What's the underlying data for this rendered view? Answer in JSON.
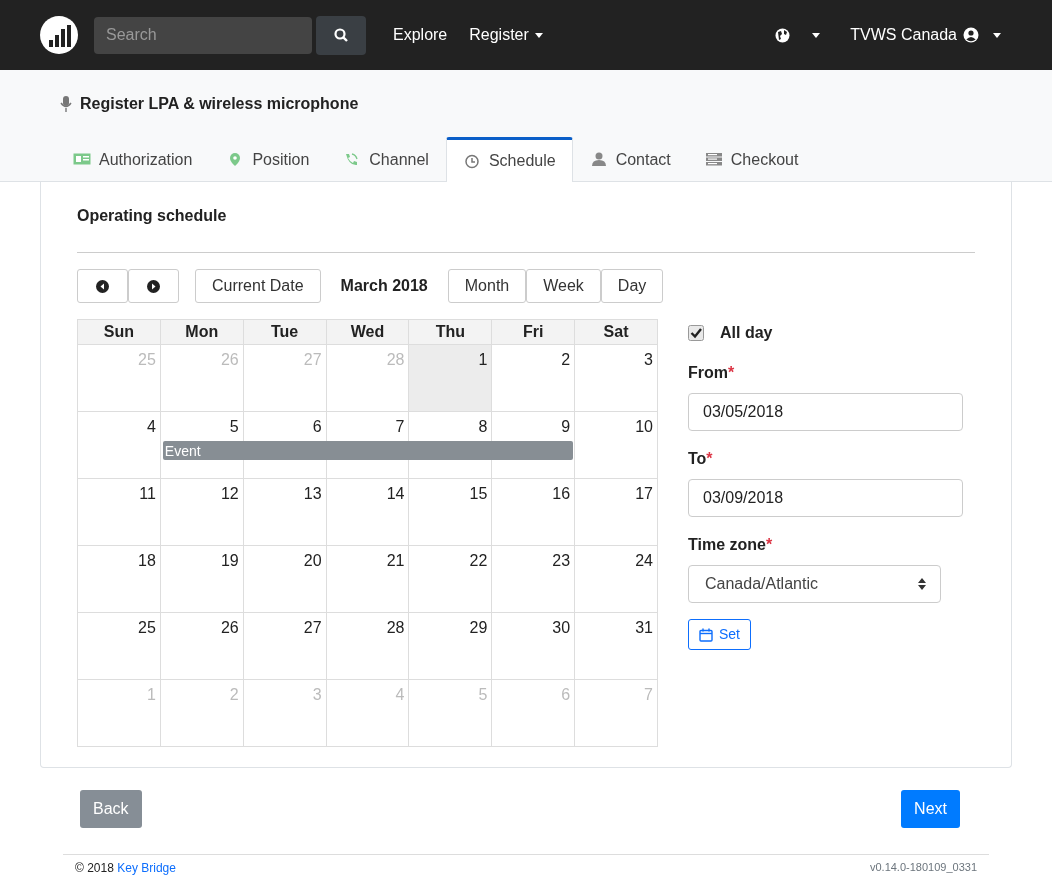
{
  "navbar": {
    "search": {
      "placeholder": "Search"
    },
    "links": [
      {
        "label": "Explore",
        "dropdown": false
      },
      {
        "label": "Register",
        "dropdown": true
      }
    ],
    "user": {
      "label": "TVWS Canada"
    }
  },
  "page_title": "Register LPA & wireless microphone",
  "tabs": [
    {
      "label": "Authorization",
      "selected": false
    },
    {
      "label": "Position",
      "selected": false
    },
    {
      "label": "Channel",
      "selected": false
    },
    {
      "label": "Schedule",
      "selected": true
    },
    {
      "label": "Contact",
      "selected": false
    },
    {
      "label": "Checkout",
      "selected": false
    }
  ],
  "section_title": "Operating schedule",
  "calendar": {
    "toolbar": {
      "current_date": "Current Date",
      "title": "March 2018",
      "views": [
        {
          "label": "Month",
          "selected": false
        },
        {
          "label": "Week",
          "selected": false
        },
        {
          "label": "Day",
          "selected": false
        }
      ]
    },
    "weekdays": [
      "Sun",
      "Mon",
      "Tue",
      "Wed",
      "Thu",
      "Fri",
      "Sat"
    ],
    "weeks": [
      {
        "days": [
          {
            "day": "25",
            "muted": true,
            "today": false
          },
          {
            "day": "26",
            "muted": true,
            "today": false
          },
          {
            "day": "27",
            "muted": true,
            "today": false
          },
          {
            "day": "28",
            "muted": true,
            "today": false
          },
          {
            "day": "1",
            "muted": false,
            "today": true
          },
          {
            "day": "2",
            "muted": false,
            "today": false
          },
          {
            "day": "3",
            "muted": false,
            "today": false
          }
        ]
      },
      {
        "days": [
          {
            "day": "4",
            "muted": false,
            "today": false
          },
          {
            "day": "5",
            "muted": false,
            "today": false
          },
          {
            "day": "6",
            "muted": false,
            "today": false
          },
          {
            "day": "7",
            "muted": false,
            "today": false
          },
          {
            "day": "8",
            "muted": false,
            "today": false
          },
          {
            "day": "9",
            "muted": false,
            "today": false
          },
          {
            "day": "10",
            "muted": false,
            "today": false
          }
        ],
        "event_row": [
          {
            "kind": "empty"
          },
          {
            "kind": "event_start",
            "label": "Event"
          },
          {
            "kind": "event_continues"
          },
          {
            "kind": "event_continues"
          },
          {
            "kind": "event_continues"
          },
          {
            "kind": "event_continues"
          },
          {
            "kind": "empty"
          }
        ]
      },
      {
        "days": [
          {
            "day": "11",
            "muted": false,
            "today": false
          },
          {
            "day": "12",
            "muted": false,
            "today": false
          },
          {
            "day": "13",
            "muted": false,
            "today": false
          },
          {
            "day": "14",
            "muted": false,
            "today": false
          },
          {
            "day": "15",
            "muted": false,
            "today": false
          },
          {
            "day": "16",
            "muted": false,
            "today": false
          },
          {
            "day": "17",
            "muted": false,
            "today": false
          }
        ]
      },
      {
        "days": [
          {
            "day": "18",
            "muted": false,
            "today": false
          },
          {
            "day": "19",
            "muted": false,
            "today": false
          },
          {
            "day": "20",
            "muted": false,
            "today": false
          },
          {
            "day": "21",
            "muted": false,
            "today": false
          },
          {
            "day": "22",
            "muted": false,
            "today": false
          },
          {
            "day": "23",
            "muted": false,
            "today": false
          },
          {
            "day": "24",
            "muted": false,
            "today": false
          }
        ]
      },
      {
        "days": [
          {
            "day": "25",
            "muted": false,
            "today": false
          },
          {
            "day": "26",
            "muted": false,
            "today": false
          },
          {
            "day": "27",
            "muted": false,
            "today": false
          },
          {
            "day": "28",
            "muted": false,
            "today": false
          },
          {
            "day": "29",
            "muted": false,
            "today": false
          },
          {
            "day": "30",
            "muted": false,
            "today": false
          },
          {
            "day": "31",
            "muted": false,
            "today": false
          }
        ]
      },
      {
        "days": [
          {
            "day": "1",
            "muted": true,
            "today": false
          },
          {
            "day": "2",
            "muted": true,
            "today": false
          },
          {
            "day": "3",
            "muted": true,
            "today": false
          },
          {
            "day": "4",
            "muted": true,
            "today": false
          },
          {
            "day": "5",
            "muted": true,
            "today": false
          },
          {
            "day": "6",
            "muted": true,
            "today": false
          },
          {
            "day": "7",
            "muted": true,
            "today": false
          }
        ]
      }
    ]
  },
  "form": {
    "all_day": {
      "label": "All day",
      "checked": true
    },
    "fields": [
      {
        "kind": "input",
        "label": "From",
        "required_mark": "*",
        "value": "03/05/2018"
      },
      {
        "kind": "input",
        "label": "To",
        "required_mark": "*",
        "value": "03/09/2018"
      },
      {
        "kind": "select",
        "label": "Time zone",
        "required_mark": "*",
        "value": "Canada/Atlantic"
      }
    ],
    "set_button": "Set"
  },
  "back_button": "Back",
  "next_button": "Next",
  "footer": {
    "copyright": "© 2018",
    "link": "Key Bridge",
    "version": "v0.14.0-180109_0331"
  }
}
